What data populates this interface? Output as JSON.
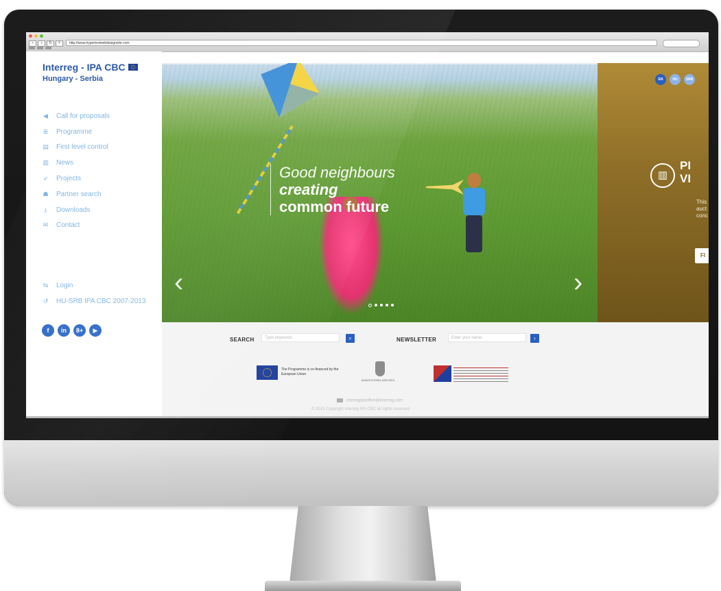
{
  "browser": {
    "url": "http://www.hypertextwebdesignsite.com"
  },
  "sidebar": {
    "logo_line1": "Interreg - IPA CBC",
    "logo_line2": "Hungary - Serbia",
    "menu": [
      {
        "label": "Call for proposals",
        "icon": "megaphone-icon"
      },
      {
        "label": "Programme",
        "icon": "document-list-icon"
      },
      {
        "label": "First level control",
        "icon": "checklist-icon"
      },
      {
        "label": "News",
        "icon": "newspaper-icon"
      },
      {
        "label": "Projects",
        "icon": "paper-plane-icon"
      },
      {
        "label": "Partner search",
        "icon": "people-icon"
      },
      {
        "label": "Downloads",
        "icon": "download-icon"
      },
      {
        "label": "Contact",
        "icon": "envelope-icon"
      }
    ],
    "secondary": [
      {
        "label": "Login",
        "icon": "login-icon"
      },
      {
        "label": "HU-SRB IPA CBC 2007-2013",
        "icon": "return-icon"
      }
    ],
    "socials": [
      {
        "label": "f",
        "icon": "facebook-icon"
      },
      {
        "label": "in",
        "icon": "linkedin-icon"
      },
      {
        "label": "8+",
        "icon": "googleplus-icon"
      },
      {
        "label": "▶",
        "icon": "youtube-icon"
      }
    ]
  },
  "hero": {
    "line1": "Good neighbours",
    "line2": "creating",
    "line3": "common future",
    "prev": "‹",
    "next": "›",
    "slides": 5,
    "active_slide": 1
  },
  "languages": [
    "EN",
    "HU",
    "SRB"
  ],
  "news_panel": {
    "title_line1": "PI",
    "title_line2": "VI",
    "text_line1": "This",
    "text_line2": "auct",
    "text_line3": "conc",
    "button": "FI"
  },
  "footer": {
    "search_label": "SEARCH",
    "search_placeholder": "Type keywords",
    "newsletter_label": "NEWSLETTER",
    "newsletter_placeholder": "Enter your name",
    "eu_text": "The Programme is co-financed by the European Union",
    "ministry_text": "MINISZTERELNÖKSÉG",
    "email": "interregipaoffice@interreg.com",
    "copyright": "© 2015 Copyright Interreg IPA CBC all rights reserved"
  },
  "colors": {
    "brand_blue": "#2b5aa8",
    "menu_blue": "#7fb4e3",
    "button_blue": "#2a5fc2",
    "news_gold": "#9c7c30"
  }
}
